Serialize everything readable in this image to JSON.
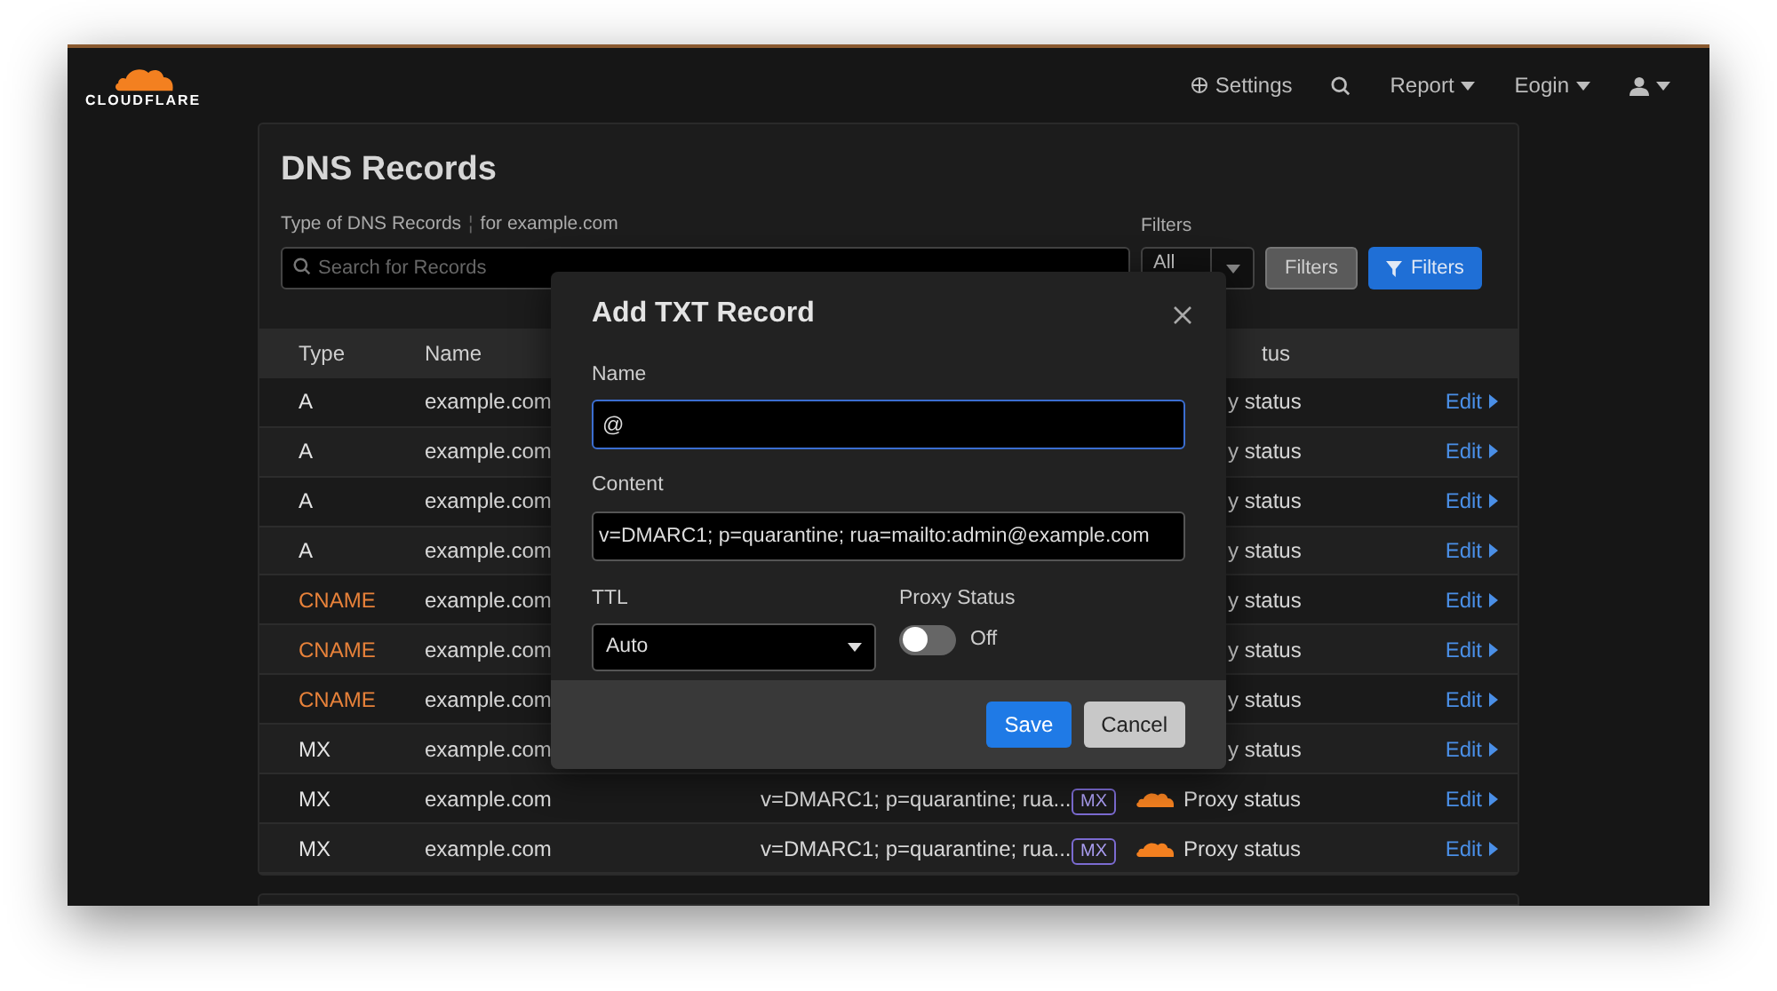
{
  "nav": {
    "logo": "CLOUDFLARE",
    "items": [
      {
        "kind": "settings",
        "label": "Settings"
      },
      {
        "kind": "search"
      },
      {
        "kind": "menu",
        "label": "Report"
      },
      {
        "kind": "menu",
        "label": "Eogin"
      },
      {
        "kind": "user"
      }
    ]
  },
  "page": {
    "title": "DNS Records",
    "subtitle": "Type of DNS Records",
    "separator": "¦",
    "subtitle_domain": "for example.com",
    "search": {
      "placeholder": "Search for Records"
    },
    "filters_label": "Filters",
    "filter_select": "All",
    "filter_buttons": [
      {
        "label": "Filters",
        "kind": "secondary"
      },
      {
        "label": "Filters",
        "kind": "primary"
      }
    ]
  },
  "table": {
    "columns": [
      "Type",
      "Name",
      "tus"
    ],
    "rows": [
      {
        "kind": "partial",
        "type": "A",
        "color": "#e5e5e5",
        "name": "example.com",
        "proxy": "y status",
        "action": "Edit"
      },
      {
        "kind": "partial",
        "type": "A",
        "color": "#e5e5e5",
        "name": "example.com",
        "proxy": "y status",
        "action": "Edit"
      },
      {
        "kind": "partial",
        "type": "A",
        "color": "#e5e5e5",
        "name": "example.com",
        "proxy": "y status",
        "action": "Edit"
      },
      {
        "kind": "partial",
        "type": "A",
        "color": "#e5e5e5",
        "name": "example.com",
        "proxy": "y status",
        "action": "Edit"
      },
      {
        "kind": "partial",
        "type": "CNAME",
        "color": "#e8823a",
        "name": "example.com",
        "proxy": "y status",
        "action": "Edit"
      },
      {
        "kind": "partial",
        "type": "CNAME",
        "color": "#e8823a",
        "name": "example.com",
        "proxy": "y status",
        "action": "Edit"
      },
      {
        "kind": "partial",
        "type": "CNAME",
        "color": "#e8823a",
        "name": "example.com",
        "proxy": "y status",
        "action": "Edit"
      },
      {
        "kind": "partial",
        "type": "MX",
        "color": "#e5e5e5",
        "name": "example.com",
        "proxy": "y status",
        "action": "Edit"
      },
      {
        "kind": "full",
        "type": "MX",
        "color": "#e5e5e5",
        "name": "example.com",
        "content": "v=DMARC1; p=quarantine; rua...",
        "badge": "MX",
        "proxy": "Proxy status",
        "action": "Edit"
      },
      {
        "kind": "full",
        "type": "MX",
        "color": "#e5e5e5",
        "name": "example.com",
        "content": "v=DMARC1; p=quarantine; rua...",
        "badge": "MX",
        "proxy": "Proxy status",
        "action": "Edit"
      }
    ]
  },
  "dialog": {
    "title": "Add TXT Record",
    "name_label": "Name",
    "name_value": "@",
    "content_label": "Content",
    "content_value": "v=DMARC1; p=quarantine; rua=mailto:admin@example.com",
    "ttl_label": "TTL",
    "ttl_value": "Auto",
    "proxy_label": "Proxy Status",
    "proxy_on": false,
    "proxy_text": "Off",
    "buttons": [
      {
        "label": "Save",
        "kind": "primary"
      },
      {
        "label": "Cancel",
        "kind": "secondary"
      }
    ]
  }
}
